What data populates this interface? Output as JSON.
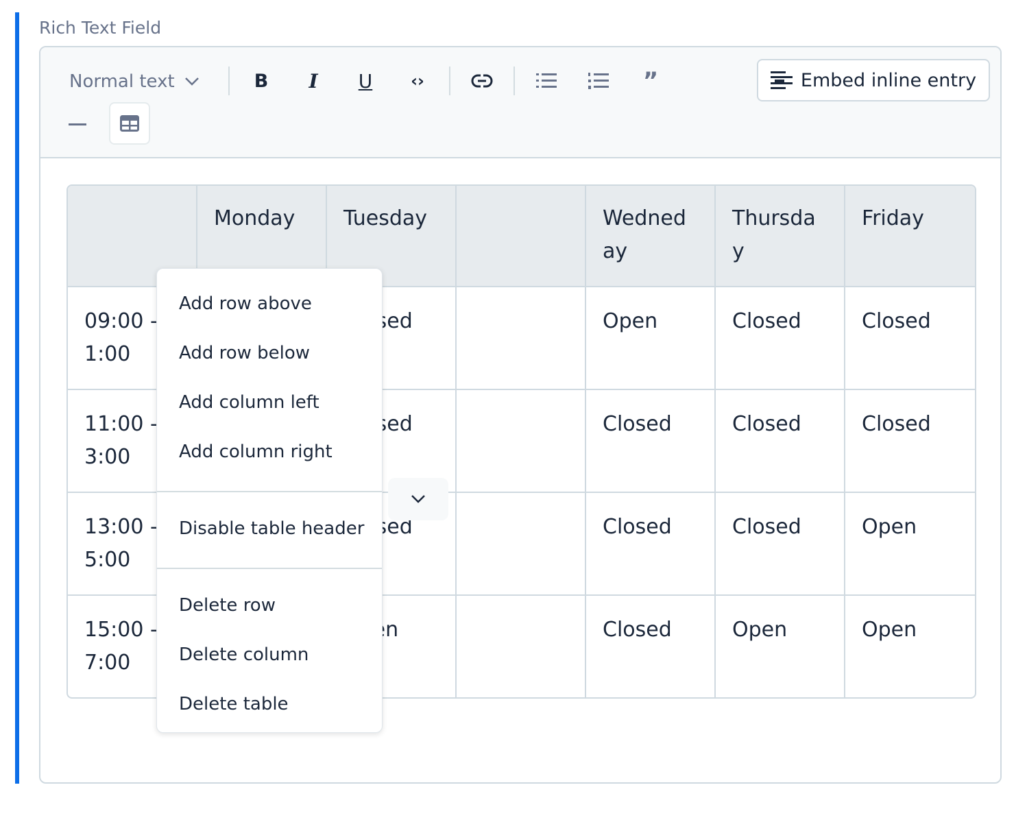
{
  "field_label": "Rich Text Field",
  "toolbar": {
    "format_select": "Normal text",
    "embed_label": "Embed inline entry",
    "icons": [
      "bold-icon",
      "italic-icon",
      "underline-icon",
      "code-icon",
      "link-icon",
      "bulleted-list-icon",
      "numbered-list-icon",
      "quote-icon",
      "horizontal-rule-icon",
      "table-icon"
    ]
  },
  "table": {
    "headers": [
      "",
      "Monday",
      "Tuesday",
      "",
      "Wedneday",
      "Thursday",
      "Friday"
    ],
    "rows": [
      [
        "09:00 - 11:00",
        "",
        "Closed",
        "",
        "Open",
        "Closed",
        "Closed"
      ],
      [
        "11:00 - 13:00",
        "",
        "Closed",
        "",
        "Closed",
        "Closed",
        "Closed"
      ],
      [
        "13:00 - 15:00",
        "",
        "Closed",
        "",
        "Closed",
        "Closed",
        "Open"
      ],
      [
        "15:00 - 17:00",
        "",
        "Open",
        "",
        "Closed",
        "Open",
        "Open"
      ]
    ]
  },
  "context_menu": {
    "items": [
      "Add row above",
      "Add row below",
      "Add column left",
      "Add column right",
      "Disable table header",
      "Delete row",
      "Delete column",
      "Delete table"
    ]
  },
  "colors": {
    "accent": "#0c6ee8",
    "border": "#cfd9e0",
    "header_bg": "#e7ebee"
  }
}
